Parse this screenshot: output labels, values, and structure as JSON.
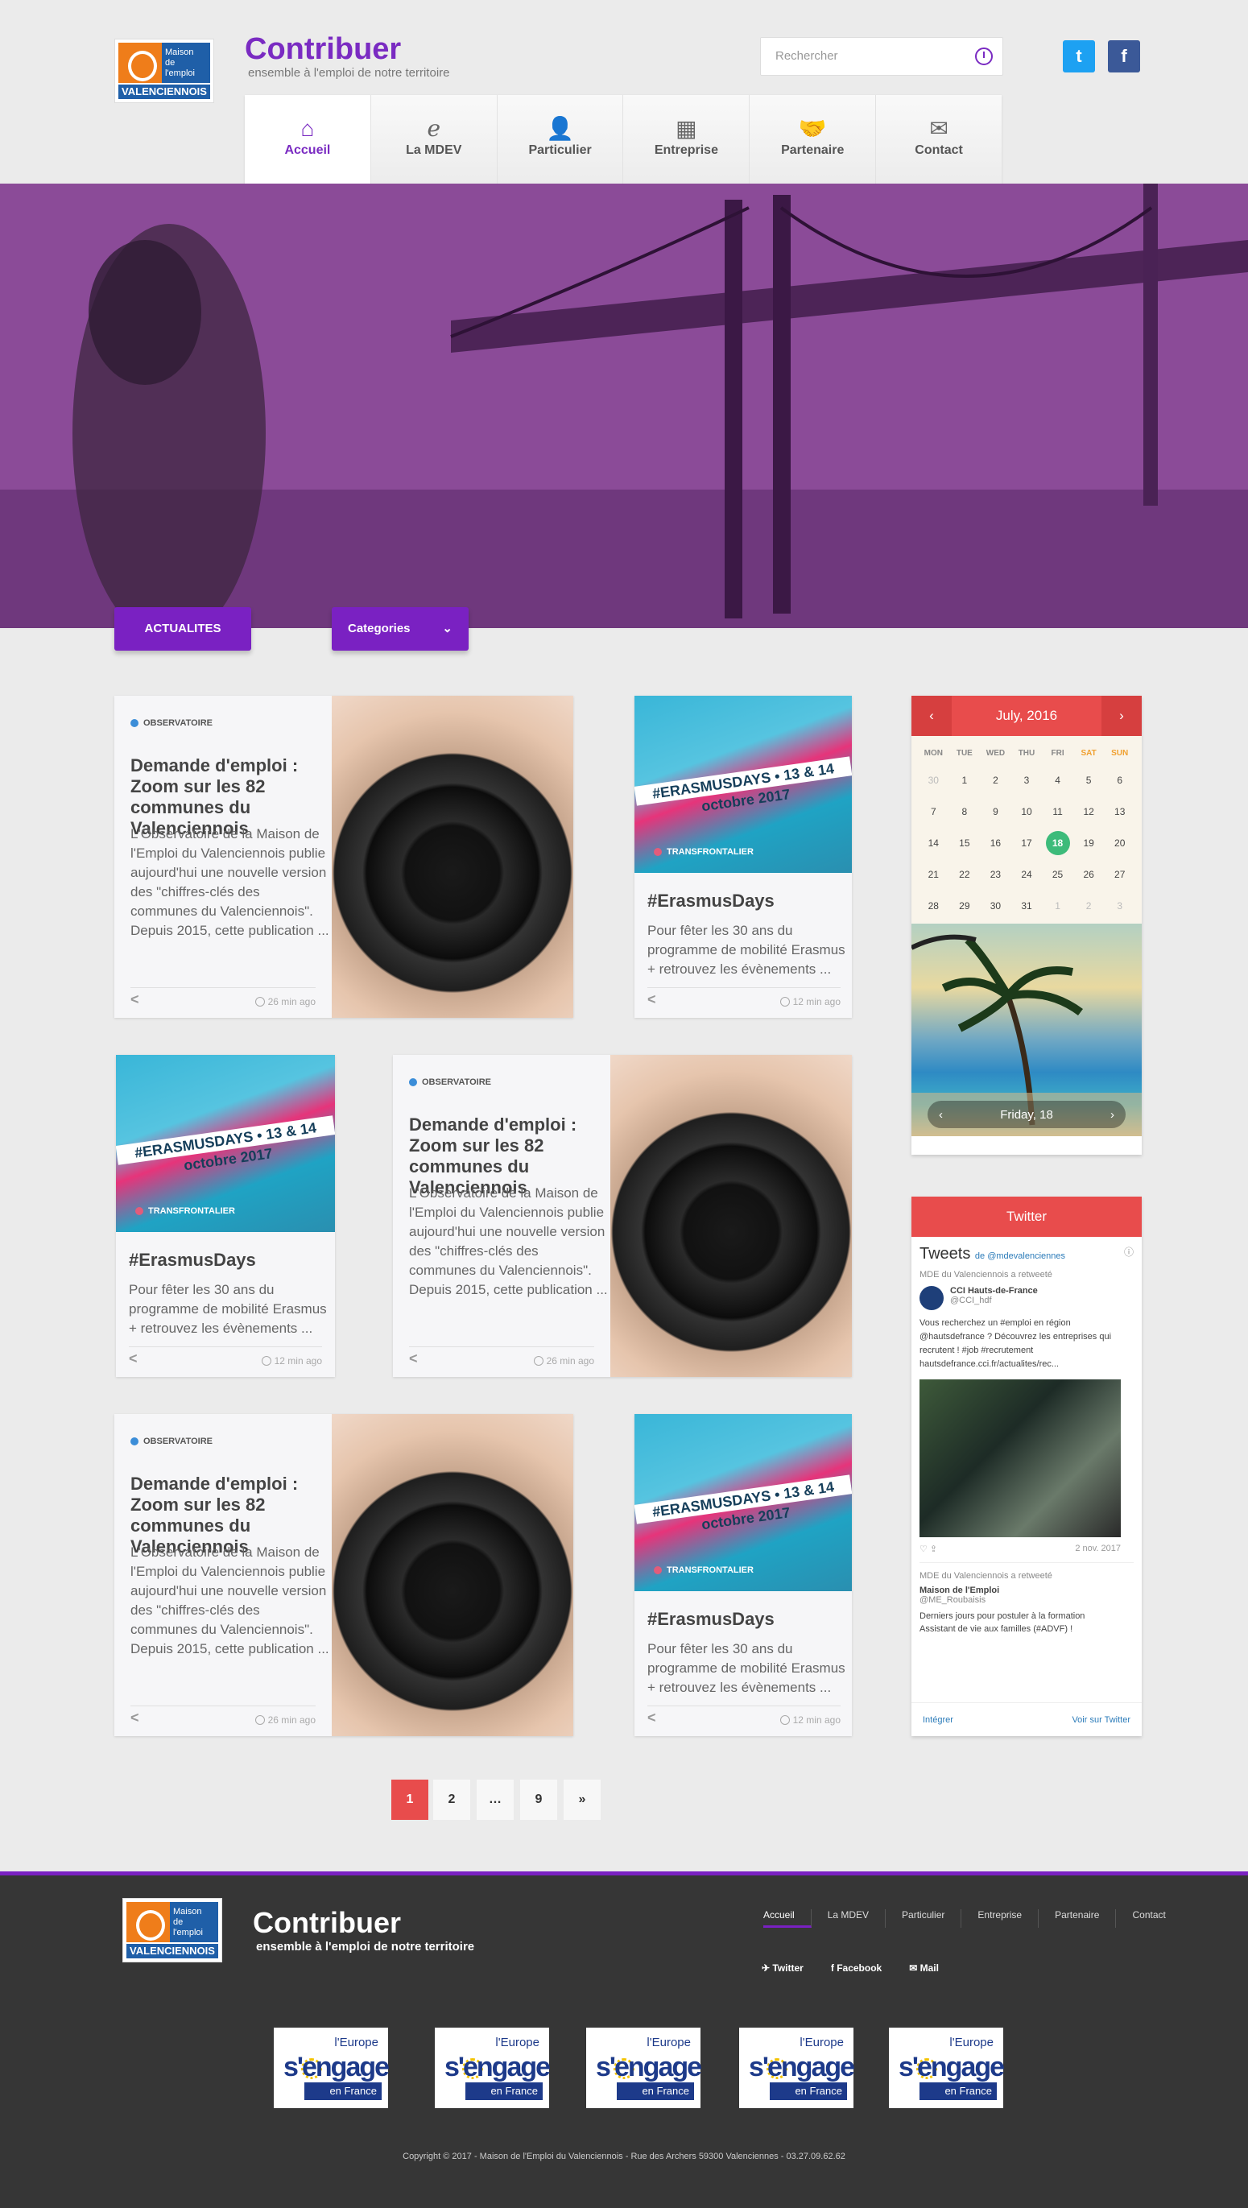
{
  "header": {
    "logo": {
      "line1": "Maison",
      "line2": "de l'emploi",
      "town": "VALENCIENNOIS"
    },
    "title": "Contribuer",
    "subtitle": "ensemble à l'emploi de notre territoire",
    "search_placeholder": "Rechercher",
    "social": {
      "twitter": "t",
      "facebook": "f"
    }
  },
  "nav": [
    {
      "label": "Accueil",
      "icon": "home-icon",
      "glyph": "⌂"
    },
    {
      "label": "La MDEV",
      "icon": "mdev-logo-icon",
      "glyph": "ℯ"
    },
    {
      "label": "Particulier",
      "icon": "person-icon",
      "glyph": "👤"
    },
    {
      "label": "Entreprise",
      "icon": "building-icon",
      "glyph": "▦"
    },
    {
      "label": "Partenaire",
      "icon": "handshake-icon",
      "glyph": "🤝"
    },
    {
      "label": "Contact",
      "icon": "envelope-icon",
      "glyph": "✉"
    }
  ],
  "filters": {
    "news": "ACTUALITES",
    "categories": "Categories"
  },
  "cards": {
    "obs": {
      "tag": "OBSERVATOIRE",
      "title": "Demande d'emploi : Zoom sur les 82 communes du Valenciennois",
      "text": "L'Observatoire de la Maison de l'Emploi du Valenciennois publie aujourd'hui une nouvelle version des \"chiffres-clés des communes du Valenciennois\". Depuis 2015, cette publication ...",
      "time": "26 min ago"
    },
    "eras": {
      "tag": "TRANSFRONTALIER",
      "banner": "#ERASMUSDAYS • 13 & 14 octobre 2017",
      "title": "#ErasmusDays",
      "text": "Pour fêter les 30 ans du programme de mobilité Erasmus + retrouvez les évènements ...",
      "time": "12 min ago"
    }
  },
  "calendar": {
    "month": "July, 2016",
    "days": [
      "MON",
      "TUE",
      "WED",
      "THU",
      "FRI",
      "SAT",
      "SUN"
    ],
    "weeks": [
      [
        "30",
        "1",
        "2",
        "3",
        "4",
        "5",
        "6"
      ],
      [
        "7",
        "8",
        "9",
        "10",
        "11",
        "12",
        "13"
      ],
      [
        "14",
        "15",
        "16",
        "17",
        "18",
        "19",
        "20"
      ],
      [
        "21",
        "22",
        "23",
        "24",
        "25",
        "26",
        "27"
      ],
      [
        "28",
        "29",
        "30",
        "31",
        "1",
        "2",
        "3"
      ]
    ],
    "selected": "18",
    "footer": "Friday, 18"
  },
  "twitter": {
    "header": "Twitter",
    "tweets_label": "Tweets",
    "by": "de @mdevalenciennes",
    "rt1": "MDE du Valenciennois a retweeté",
    "author1": "CCI Hauts-de-France",
    "handle1": "@CCI_hdf",
    "text1": "Vous recherchez un #emploi en région @hautsdefrance ? Découvrez les entreprises qui recrutent ! #job #recrutement hautsdefrance.cci.fr/actualites/rec...",
    "date1": "2 nov. 2017",
    "rt2": "MDE du Valenciennois a retweeté",
    "author2": "Maison de l'Emploi",
    "handle2": "@ME_Roubaisis",
    "text2": "Derniers jours pour postuler à la formation Assistant de vie aux familles (#ADVF) !",
    "embed": "Intégrer",
    "view": "Voir sur Twitter"
  },
  "pagination": [
    "1",
    "2",
    "…",
    "9",
    "»"
  ],
  "footer": {
    "title": "Contribuer",
    "subtitle": "ensemble à l'emploi de notre territoire",
    "nav": [
      "Accueil",
      "La MDEV",
      "Particulier",
      "Entreprise",
      "Partenaire",
      "Contact"
    ],
    "social": [
      "Twitter",
      "Facebook",
      "Mail"
    ],
    "eu": {
      "line1": "l'Europe",
      "line2": "s'engage",
      "line3": "en France"
    },
    "copyright": "Copyright © 2017 - Maison de l'Emploi du Valenciennois - Rue des Archers 59300 Valenciennes - 03.27.09.62.62"
  },
  "colors": {
    "accent": "#7a21c2",
    "red": "#e84c4c",
    "green": "#3dbb7a"
  }
}
